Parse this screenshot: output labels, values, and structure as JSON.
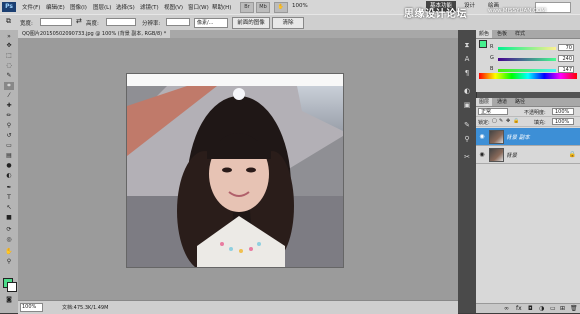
{
  "menubar": {
    "logo": "Ps",
    "items": [
      "文件(F)",
      "编辑(E)",
      "图像(I)",
      "图层(L)",
      "选择(S)",
      "滤镜(T)",
      "视图(V)",
      "窗口(W)",
      "帮助(H)"
    ],
    "zoom": "100%",
    "workspaces": [
      "基本功能",
      "设计",
      "绘画"
    ],
    "active_workspace": "基本功能"
  },
  "watermark": {
    "text": "思缘设计论坛",
    "url": "www.MISSYUAN.COM"
  },
  "options": {
    "width_label": "宽度:",
    "height_label": "高度:",
    "resolution_label": "分辨率:",
    "unit": "像素/...",
    "front_image_button": "前面的图像",
    "clear_button": "清除"
  },
  "document": {
    "tab_title": "QQ图片20150502090733.jpg @ 100% (背景 副本, RGB/8) *",
    "zoom": "100%",
    "info": "文档:475.3K/1.49M"
  },
  "color_panel": {
    "tabs": [
      "颜色",
      "色板",
      "样式"
    ],
    "active_tab": "颜色",
    "channels": [
      {
        "label": "R",
        "value": "70"
      },
      {
        "label": "G",
        "value": "240"
      },
      {
        "label": "B",
        "value": "147"
      }
    ],
    "foreground": "#46f08f"
  },
  "layers_panel": {
    "tabs": [
      "图层",
      "通道",
      "路径"
    ],
    "active_tab": "图层",
    "blend_mode": "正常",
    "opacity_label": "不透明度:",
    "opacity": "100%",
    "lock_label": "锁定:",
    "fill_label": "填充:",
    "fill": "100%",
    "layers": [
      {
        "name": "背景 副本",
        "selected": true
      },
      {
        "name": "背景",
        "selected": false
      }
    ]
  }
}
